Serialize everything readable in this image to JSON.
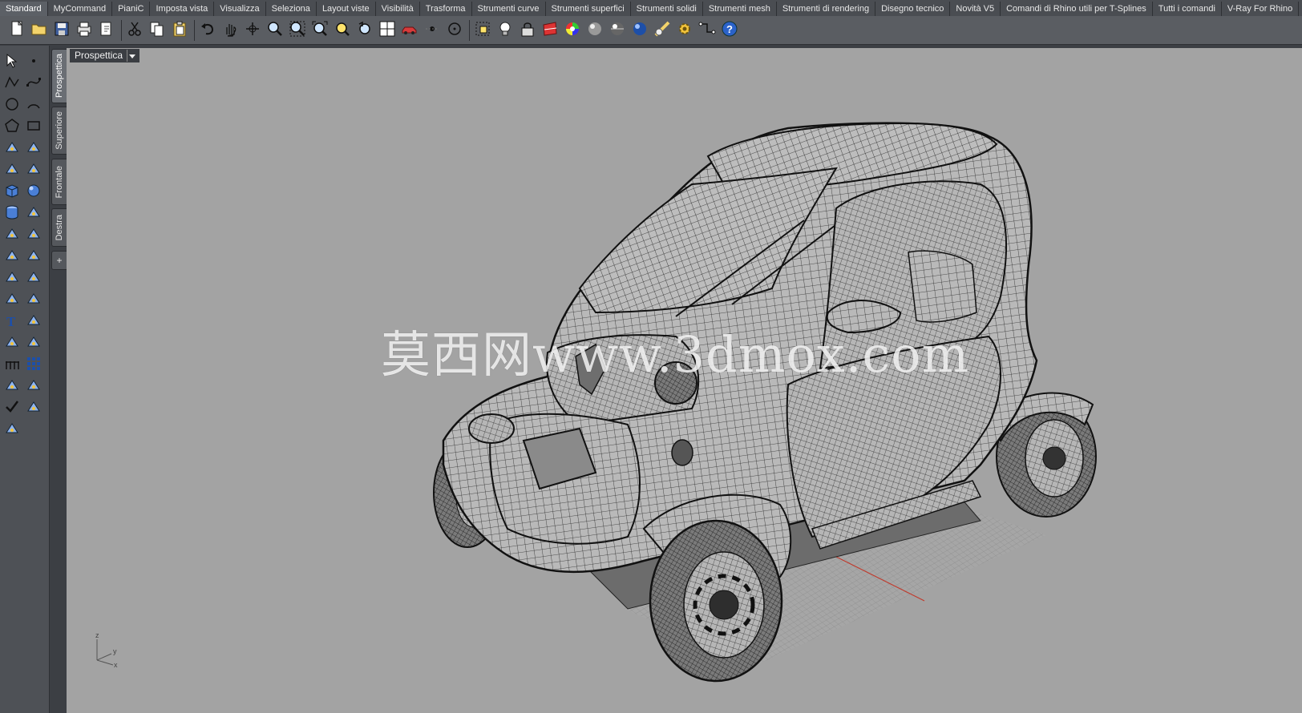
{
  "tabs": [
    {
      "label": "Standard",
      "active": true
    },
    {
      "label": "MyCommand"
    },
    {
      "label": "PianiC"
    },
    {
      "label": "Imposta vista"
    },
    {
      "label": "Visualizza"
    },
    {
      "label": "Seleziona"
    },
    {
      "label": "Layout viste"
    },
    {
      "label": "Visibilità"
    },
    {
      "label": "Trasforma"
    },
    {
      "label": "Strumenti curve"
    },
    {
      "label": "Strumenti superfici"
    },
    {
      "label": "Strumenti solidi"
    },
    {
      "label": "Strumenti mesh"
    },
    {
      "label": "Strumenti di rendering"
    },
    {
      "label": "Disegno tecnico"
    },
    {
      "label": "Novità V5"
    },
    {
      "label": "Comandi di Rhino utili per T-Splines"
    },
    {
      "label": "Tutti i comandi"
    },
    {
      "label": "V-Ray For Rhino"
    }
  ],
  "toolbar_icons": [
    "new-icon",
    "open-icon",
    "save-icon",
    "print-icon",
    "import-icon",
    "cut-icon",
    "copy-icon",
    "paste-icon",
    "undo-icon",
    "pan-icon",
    "rotate-view-icon",
    "zoom-icon",
    "zoom-window-icon",
    "zoom-extents-icon",
    "zoom-selected-icon",
    "undo-view-icon",
    "four-viewports-icon",
    "car-icon",
    "point-icon",
    "circle-icon",
    "select-icon",
    "light-icon",
    "lock-icon",
    "material-icon",
    "color-wheel-icon",
    "shaded-sphere-icon",
    "rendered-sphere-icon",
    "blue-sphere-icon",
    "render-icon",
    "settings-gear-icon",
    "snap-icon",
    "help-icon"
  ],
  "viewport_tabs": [
    {
      "label": "Prospettica",
      "active": true
    },
    {
      "label": "Superiore"
    },
    {
      "label": "Frontale"
    },
    {
      "label": "Destra"
    }
  ],
  "viewport": {
    "title": "Prospettica",
    "watermark": "莫西网www.3dmox.com",
    "axis": {
      "z": "z",
      "y": "y",
      "x": "x"
    }
  },
  "colors": {
    "viewport_bg": "#a3a3a3",
    "grid_red_axis": "#c0392b",
    "toolbar_bg": "#5a5d62",
    "tab_bg": "#4a4d52"
  }
}
